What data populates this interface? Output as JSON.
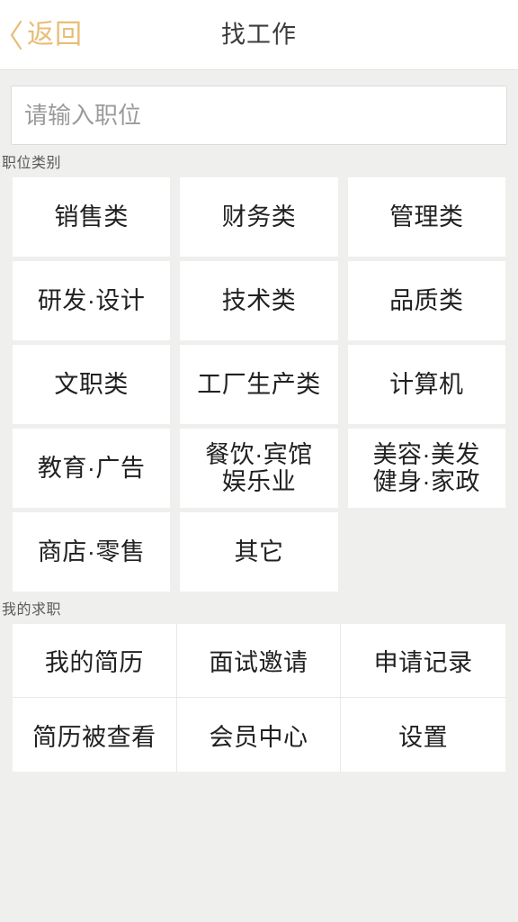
{
  "header": {
    "back_label": "返回",
    "back_icon": "chevron-left-icon",
    "title": "找工作",
    "accent_color": "#e9bd76",
    "title_color": "#3c3c3c"
  },
  "search": {
    "value": "",
    "placeholder": "请输入职位"
  },
  "categories": {
    "section_label": "职位类别",
    "items": [
      {
        "label": "销售类"
      },
      {
        "label": "财务类"
      },
      {
        "label": "管理类"
      },
      {
        "label": "研发·设计"
      },
      {
        "label": "技术类"
      },
      {
        "label": "品质类"
      },
      {
        "label": "文职类"
      },
      {
        "label": "工厂生产类"
      },
      {
        "label": "计算机"
      },
      {
        "label": "教育·广告"
      },
      {
        "line1": "餐饮·宾馆",
        "line2": "娱乐业"
      },
      {
        "line1": "美容·美发",
        "line2": "健身·家政"
      },
      {
        "label": "商店·零售"
      },
      {
        "label": "其它"
      },
      {
        "label": "",
        "empty": true
      }
    ]
  },
  "my_jobs": {
    "section_label": "我的求职",
    "items": [
      {
        "label": "我的简历"
      },
      {
        "label": "面试邀请"
      },
      {
        "label": "申请记录"
      },
      {
        "label": "简历被查看"
      },
      {
        "label": "会员中心"
      },
      {
        "label": "设置"
      }
    ]
  },
  "theme": {
    "page_background": "#efefee",
    "card_background": "#ffffff",
    "divider": "#e8e8e8",
    "text_primary": "#212121",
    "text_secondary": "#5a5a5a",
    "placeholder": "#9b9b9b"
  }
}
